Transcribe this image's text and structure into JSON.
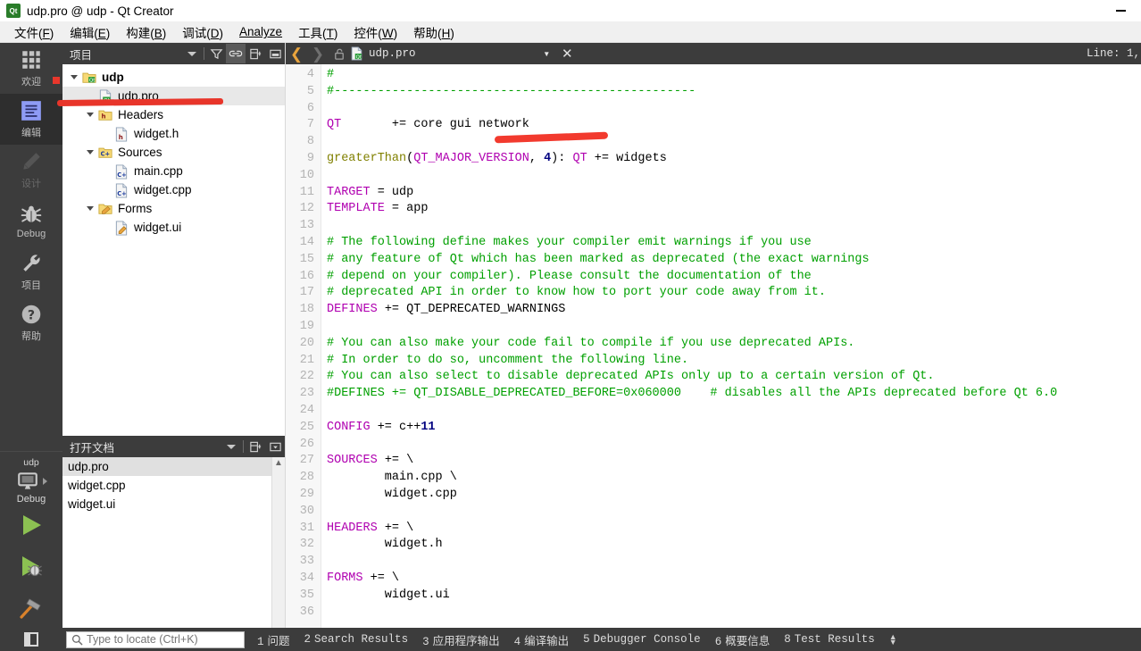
{
  "window": {
    "title": "udp.pro @ udp - Qt Creator",
    "app_icon": "qt-logo-icon",
    "minimize_label": "—"
  },
  "menubar": {
    "items": [
      {
        "label": "文件(F)",
        "name": "menu-file"
      },
      {
        "label": "编辑(E)",
        "name": "menu-edit"
      },
      {
        "label": "构建(B)",
        "name": "menu-build"
      },
      {
        "label": "调试(D)",
        "name": "menu-debug"
      },
      {
        "label": "Analyze",
        "name": "menu-analyze"
      },
      {
        "label": "工具(T)",
        "name": "menu-tools"
      },
      {
        "label": "控件(W)",
        "name": "menu-window"
      },
      {
        "label": "帮助(H)",
        "name": "menu-help"
      }
    ]
  },
  "modebar": {
    "modes": [
      {
        "label": "欢迎",
        "icon": "grid-icon",
        "active": false,
        "disabled": false,
        "badge": true
      },
      {
        "label": "编辑",
        "icon": "document-lines-icon",
        "active": true,
        "disabled": false,
        "badge": false
      },
      {
        "label": "设计",
        "icon": "pencil-icon",
        "active": false,
        "disabled": true,
        "badge": false
      },
      {
        "label": "Debug",
        "icon": "bug-icon",
        "active": false,
        "disabled": false,
        "badge": false
      },
      {
        "label": "项目",
        "icon": "wrench-icon",
        "active": false,
        "disabled": false,
        "badge": false
      },
      {
        "label": "帮助",
        "icon": "question-circle-icon",
        "active": false,
        "disabled": false,
        "badge": false
      }
    ],
    "kit": {
      "project_name": "udp",
      "icon": "desktop-monitor-icon",
      "build_config": "Debug",
      "expand_arrow": "▸"
    },
    "run_buttons": [
      {
        "name": "run-button",
        "icon": "green-play-icon"
      },
      {
        "name": "debug-run-button",
        "icon": "green-play-bug-icon"
      },
      {
        "name": "build-button",
        "icon": "hammer-icon"
      }
    ]
  },
  "project_dock": {
    "title": "项目",
    "toolbar": [
      {
        "name": "project-filter-dropdown",
        "icon": "chevron-down-icon"
      },
      {
        "name": "filter-button",
        "icon": "funnel-icon"
      },
      {
        "name": "sync-editor-button",
        "icon": "link-icon",
        "active": true
      },
      {
        "name": "split-button",
        "icon": "split-icon"
      },
      {
        "name": "close-dock-button",
        "icon": "minimize-dock-icon"
      }
    ],
    "tree": [
      {
        "label": "udp",
        "indent": 0,
        "twisty": true,
        "icon": "qt-project-icon",
        "bold": true,
        "selected": false
      },
      {
        "label": "udp.pro",
        "indent": 1,
        "twisty": false,
        "icon": "qt-pro-file-icon",
        "bold": false,
        "selected": true
      },
      {
        "label": "Headers",
        "indent": 1,
        "twisty": true,
        "icon": "headers-folder-icon",
        "bold": false,
        "selected": false
      },
      {
        "label": "widget.h",
        "indent": 2,
        "twisty": false,
        "icon": "h-file-icon",
        "bold": false,
        "selected": false
      },
      {
        "label": "Sources",
        "indent": 1,
        "twisty": true,
        "icon": "sources-folder-icon",
        "bold": false,
        "selected": false
      },
      {
        "label": "main.cpp",
        "indent": 2,
        "twisty": false,
        "icon": "cpp-file-icon",
        "bold": false,
        "selected": false
      },
      {
        "label": "widget.cpp",
        "indent": 2,
        "twisty": false,
        "icon": "cpp-file-icon",
        "bold": false,
        "selected": false
      },
      {
        "label": "Forms",
        "indent": 1,
        "twisty": true,
        "icon": "forms-folder-icon",
        "bold": false,
        "selected": false
      },
      {
        "label": "widget.ui",
        "indent": 2,
        "twisty": false,
        "icon": "ui-file-icon",
        "bold": false,
        "selected": false
      }
    ]
  },
  "opendocs_dock": {
    "title": "打开文档",
    "toolbar": [
      {
        "name": "opendocs-dropdown",
        "icon": "chevron-down-icon"
      },
      {
        "name": "split-button",
        "icon": "split-icon"
      },
      {
        "name": "close-dock-button",
        "icon": "dock-menu-icon"
      }
    ],
    "items": [
      {
        "label": "udp.pro",
        "selected": true
      },
      {
        "label": "widget.cpp",
        "selected": false
      },
      {
        "label": "widget.ui",
        "selected": false
      }
    ]
  },
  "editor": {
    "toolbar": {
      "back_icon": "chevron-left-icon",
      "forward_icon": "chevron-right-icon",
      "lock_icon": "unlocked-padlock-icon",
      "file_icon": "qt-pro-file-icon",
      "filename": "udp.pro",
      "dropdown_icon": "chevron-down-icon",
      "close_label": "✕",
      "line_info": "Line: 1,"
    },
    "first_line_number": 4,
    "lines": [
      {
        "n": 4,
        "tokens": [
          {
            "t": "#",
            "c": "cm"
          }
        ]
      },
      {
        "n": 5,
        "tokens": [
          {
            "t": "#--------------------------------------------------",
            "c": "cm"
          }
        ]
      },
      {
        "n": 6,
        "tokens": []
      },
      {
        "n": 7,
        "tokens": [
          {
            "t": "QT",
            "c": "var"
          },
          {
            "t": "       += core gui network",
            "c": "pl"
          }
        ]
      },
      {
        "n": 8,
        "tokens": []
      },
      {
        "n": 9,
        "tokens": [
          {
            "t": "greaterThan",
            "c": "fn"
          },
          {
            "t": "(",
            "c": "pl"
          },
          {
            "t": "QT_MAJOR_VERSION",
            "c": "var"
          },
          {
            "t": ", ",
            "c": "pl"
          },
          {
            "t": "4",
            "c": "num"
          },
          {
            "t": "): ",
            "c": "pl"
          },
          {
            "t": "QT",
            "c": "var"
          },
          {
            "t": " += widgets",
            "c": "pl"
          }
        ]
      },
      {
        "n": 10,
        "tokens": []
      },
      {
        "n": 11,
        "tokens": [
          {
            "t": "TARGET",
            "c": "var"
          },
          {
            "t": " = udp",
            "c": "pl"
          }
        ]
      },
      {
        "n": 12,
        "tokens": [
          {
            "t": "TEMPLATE",
            "c": "var"
          },
          {
            "t": " = app",
            "c": "pl"
          }
        ]
      },
      {
        "n": 13,
        "tokens": []
      },
      {
        "n": 14,
        "tokens": [
          {
            "t": "# The following define makes your compiler emit warnings if you use",
            "c": "cm"
          }
        ]
      },
      {
        "n": 15,
        "tokens": [
          {
            "t": "# any feature of Qt which has been marked as deprecated (the exact warnings",
            "c": "cm"
          }
        ]
      },
      {
        "n": 16,
        "tokens": [
          {
            "t": "# depend on your compiler). Please consult the documentation of the",
            "c": "cm"
          }
        ]
      },
      {
        "n": 17,
        "tokens": [
          {
            "t": "# deprecated API in order to know how to port your code away from it.",
            "c": "cm"
          }
        ]
      },
      {
        "n": 18,
        "tokens": [
          {
            "t": "DEFINES",
            "c": "var"
          },
          {
            "t": " += QT_DEPRECATED_WARNINGS",
            "c": "pl"
          }
        ]
      },
      {
        "n": 19,
        "tokens": []
      },
      {
        "n": 20,
        "tokens": [
          {
            "t": "# You can also make your code fail to compile if you use deprecated APIs.",
            "c": "cm"
          }
        ]
      },
      {
        "n": 21,
        "tokens": [
          {
            "t": "# In order to do so, uncomment the following line.",
            "c": "cm"
          }
        ]
      },
      {
        "n": 22,
        "tokens": [
          {
            "t": "# You can also select to disable deprecated APIs only up to a certain version of Qt.",
            "c": "cm"
          }
        ]
      },
      {
        "n": 23,
        "tokens": [
          {
            "t": "#DEFINES += QT_DISABLE_DEPRECATED_BEFORE=0x060000    # disables all the APIs deprecated before Qt 6.0",
            "c": "cm"
          }
        ]
      },
      {
        "n": 24,
        "tokens": []
      },
      {
        "n": 25,
        "tokens": [
          {
            "t": "CONFIG",
            "c": "var"
          },
          {
            "t": " += c++",
            "c": "pl"
          },
          {
            "t": "11",
            "c": "num"
          }
        ]
      },
      {
        "n": 26,
        "tokens": []
      },
      {
        "n": 27,
        "tokens": [
          {
            "t": "SOURCES",
            "c": "var"
          },
          {
            "t": " += \\",
            "c": "pl"
          }
        ]
      },
      {
        "n": 28,
        "tokens": [
          {
            "t": "        main.cpp \\",
            "c": "pl"
          }
        ]
      },
      {
        "n": 29,
        "tokens": [
          {
            "t": "        widget.cpp",
            "c": "pl"
          }
        ]
      },
      {
        "n": 30,
        "tokens": []
      },
      {
        "n": 31,
        "tokens": [
          {
            "t": "HEADERS",
            "c": "var"
          },
          {
            "t": " += \\",
            "c": "pl"
          }
        ]
      },
      {
        "n": 32,
        "tokens": [
          {
            "t": "        widget.h",
            "c": "pl"
          }
        ]
      },
      {
        "n": 33,
        "tokens": []
      },
      {
        "n": 34,
        "tokens": [
          {
            "t": "FORMS",
            "c": "var"
          },
          {
            "t": " += \\",
            "c": "pl"
          }
        ]
      },
      {
        "n": 35,
        "tokens": [
          {
            "t": "        widget.ui",
            "c": "pl"
          }
        ]
      },
      {
        "n": 36,
        "tokens": []
      }
    ]
  },
  "statusbar": {
    "sidebar_toggle_icon": "sidebar-toggle-icon",
    "locator": {
      "icon": "search-icon",
      "placeholder": "Type to locate (Ctrl+K)",
      "value": ""
    },
    "panes": [
      {
        "num": "1",
        "label": "问题"
      },
      {
        "num": "2",
        "label": "Search Results"
      },
      {
        "num": "3",
        "label": "应用程序输出"
      },
      {
        "num": "4",
        "label": "编译输出"
      },
      {
        "num": "5",
        "label": "Debugger Console"
      },
      {
        "num": "6",
        "label": "概要信息"
      },
      {
        "num": "8",
        "label": "Test Results"
      }
    ],
    "updown_icon": "up-down-arrows-icon"
  },
  "annotations": {
    "colors": {
      "marker_red": "#e8352a"
    },
    "marks": [
      {
        "name": "red-underline-udp-pro",
        "target": "udp.pro tree item"
      },
      {
        "name": "red-underline-network",
        "target": "network keyword in line 7"
      }
    ]
  },
  "colors": {
    "dark_chrome": "#3c3c3c",
    "mode_active": "#2e2e2e",
    "accent_orange": "#e8a33d",
    "var_magenta": "#b000b0",
    "fn_olive": "#808000",
    "comment_green": "#00a000"
  }
}
